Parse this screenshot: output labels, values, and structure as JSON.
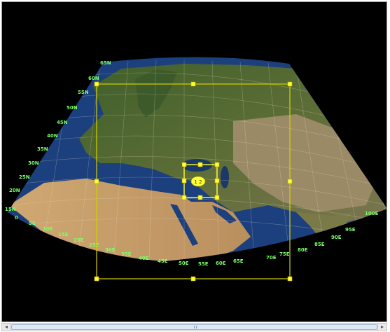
{
  "map": {
    "lat_labels": [
      "65N",
      "60N",
      "55N",
      "50N",
      "45N",
      "40N",
      "35N",
      "30N",
      "25N",
      "20N",
      "15N"
    ],
    "lon_labels": [
      "0",
      "5E",
      "10E",
      "15E",
      "20E",
      "25E",
      "30E",
      "35E",
      "40E",
      "45E",
      "50E",
      "55E",
      "60E",
      "65E",
      "70E",
      "75E",
      "80E",
      "85E",
      "90E",
      "95E",
      "100E"
    ],
    "inner_domain_label": "1 2",
    "colors": {
      "ocean": "#1c3f7d",
      "land": "#4f6b2f",
      "desert": "#c9a372",
      "labels": "#7dff6a",
      "domain_box": "#d4d000",
      "handles": "#ffff33"
    }
  },
  "scrollbar": {
    "left_arrow": "◂",
    "right_arrow": "▸"
  }
}
